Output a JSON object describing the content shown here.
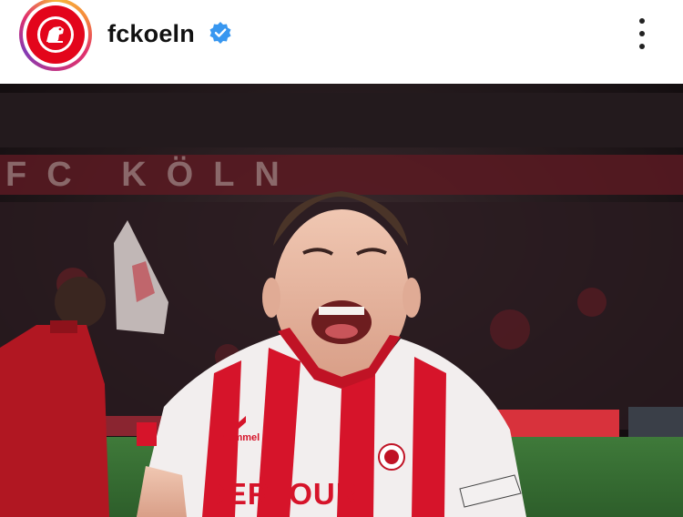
{
  "post": {
    "username": "fckoeln",
    "verified": true,
    "avatar_icon": "fc-koeln-crest-icon",
    "menu_icon": "more-vertical-icon"
  },
  "photo": {
    "banner_text": "FC KÖLN",
    "kit_brand": "hummel",
    "sponsor_text": "DERTOUR"
  },
  "colors": {
    "brand_red": "#e3051b",
    "verified_blue": "#3897f0"
  }
}
